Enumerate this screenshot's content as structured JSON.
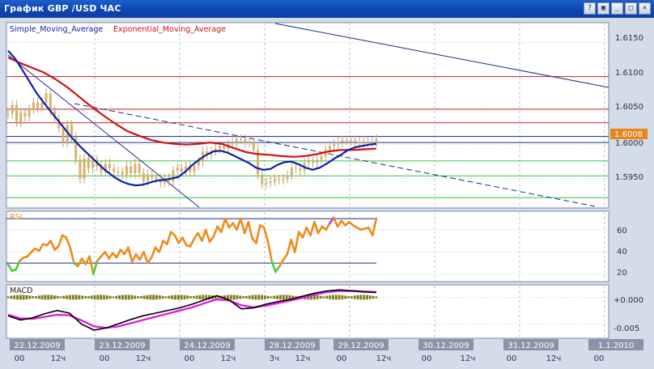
{
  "window": {
    "title": "График GBP /USD  ЧАС",
    "buttons": [
      "?",
      "▣",
      "_",
      "□",
      "✕"
    ]
  },
  "colors": {
    "background": "#ffffff",
    "sma": "#0b1fa8",
    "ema": "#d01010",
    "rsi": "#f08a1a",
    "rsi_low": "#4ccc3c",
    "rsi_high": "#d030d0",
    "macd_main": "#000000",
    "macd_signal": "#e020e0",
    "macd_hist": "#7b7a14",
    "price_tag": "#e8841a"
  },
  "chart_data": [
    {
      "type": "line",
      "name": "price",
      "legend": [
        "Simple_Moving_Average",
        "Exponential_Moving_Average"
      ],
      "y_ticks": [
        "1.6150",
        "1.6100",
        "1.6050",
        "1.6000",
        "1.5950"
      ],
      "ylim": [
        1.5908,
        1.6178
      ],
      "current_price_label": "1.6008",
      "current_price": 1.6008,
      "grid": true,
      "horizontal_levels": {
        "red": [
          1.61,
          1.6052,
          1.6032
        ],
        "navy": [
          1.6012,
          1.6003
        ],
        "green": [
          1.5976,
          1.5954,
          1.5922
        ]
      },
      "x_index_range": [
        0,
        125
      ],
      "candles_close": [
        1.6045,
        1.6058,
        1.6033,
        1.6047,
        1.6041,
        1.6052,
        1.6062,
        1.6054,
        1.6062,
        1.6075,
        1.6049,
        1.6038,
        1.6024,
        1.6003,
        1.6029,
        1.6011,
        1.5978,
        1.595,
        1.598,
        1.5965,
        1.5978,
        1.5968,
        1.596,
        1.5972,
        1.5965,
        1.596,
        1.596,
        1.5956,
        1.5968,
        1.5958,
        1.5972,
        1.5958,
        1.5946,
        1.5956,
        1.5952,
        1.595,
        1.5944,
        1.5951,
        1.5946,
        1.5962,
        1.5966,
        1.596,
        1.5968,
        1.596,
        1.5969,
        1.5975,
        1.599,
        1.5985,
        1.599,
        1.5994,
        1.5998,
        1.5994,
        1.6001,
        1.6003,
        1.6008,
        1.6008,
        1.6003,
        1.6003,
        1.5992,
        1.5956,
        1.5942,
        1.5944,
        1.5946,
        1.5949,
        1.5948,
        1.595,
        1.5955,
        1.5966,
        1.5965,
        1.5962,
        1.5973,
        1.5975,
        1.5973,
        1.5978,
        1.5983,
        1.5992,
        1.5998,
        1.6001,
        1.6004,
        1.6006,
        1.6006,
        1.6006,
        1.6004,
        1.6002,
        1.6003,
        1.6004,
        1.6003,
        1.6008
      ],
      "sma": [
        1.6138,
        1.6126,
        1.611,
        1.6093,
        1.6076,
        1.6062,
        1.6049,
        1.6036,
        1.6023,
        1.601,
        1.5999,
        1.5989,
        1.5979,
        1.5969,
        1.596,
        1.5952,
        1.5946,
        1.5942,
        1.594,
        1.5941,
        1.5944,
        1.5947,
        1.5948,
        1.595,
        1.5952,
        1.596,
        1.597,
        1.5978,
        1.5985,
        1.599,
        1.5991,
        1.5988,
        1.5983,
        1.5978,
        1.5973,
        1.5966,
        1.5963,
        1.5964,
        1.597,
        1.5974,
        1.5975,
        1.5971,
        1.5966,
        1.5963,
        1.5966,
        1.5972,
        1.5979,
        1.5985,
        1.5992,
        1.5996,
        1.5998,
        1.6,
        1.6001
      ],
      "ema": [
        1.6128,
        1.612,
        1.6113,
        1.6106,
        1.6096,
        1.6084,
        1.607,
        1.6056,
        1.6043,
        1.6031,
        1.602,
        1.6013,
        1.6007,
        1.6003,
        1.6001,
        1.6,
        1.6001,
        1.6003,
        1.6001,
        1.5995,
        1.5989,
        1.5986,
        1.5985,
        1.5983,
        1.5982,
        1.5983,
        1.5986,
        1.599,
        1.5992,
        1.5992,
        1.5993,
        1.5994
      ]
    },
    {
      "type": "line",
      "name": "RSI",
      "label": "RSI",
      "y_ticks": [
        "60",
        "40",
        "20"
      ],
      "ylim": [
        14,
        76
      ],
      "levels": [
        70,
        30
      ],
      "values": [
        29,
        23,
        24,
        32,
        35,
        36,
        40,
        43,
        41,
        47,
        46,
        50,
        42,
        45,
        55,
        53,
        44,
        30,
        27,
        34,
        29,
        36,
        20,
        32,
        36,
        40,
        34,
        39,
        35,
        42,
        38,
        44,
        31,
        38,
        33,
        40,
        30,
        35,
        44,
        40,
        50,
        47,
        58,
        55,
        48,
        53,
        46,
        45,
        52,
        57,
        50,
        60,
        49,
        54,
        63,
        58,
        70,
        62,
        66,
        60,
        70,
        57,
        67,
        52,
        48,
        64,
        62,
        50,
        32,
        22,
        27,
        33,
        38,
        51,
        40,
        58,
        53,
        62,
        55,
        67,
        57,
        63,
        60,
        66,
        71,
        63,
        68,
        64,
        67,
        64,
        62,
        60,
        61,
        62,
        55,
        70
      ]
    },
    {
      "type": "line",
      "name": "MACD",
      "label": "MACD",
      "y_ticks": [
        "+0.000",
        "-0.005"
      ],
      "ylim": [
        -0.0076,
        0.0022
      ],
      "main": [
        -0.0035,
        -0.0043,
        -0.0039,
        -0.0031,
        -0.0025,
        -0.003,
        -0.0051,
        -0.0062,
        -0.0058,
        -0.005,
        -0.0042,
        -0.0035,
        -0.003,
        -0.0025,
        -0.002,
        -0.0013,
        -0.0005,
        0.0003,
        -0.0005,
        -0.0022,
        -0.002,
        -0.0013,
        -0.0008,
        -0.0004,
        0.0002,
        0.0008,
        0.0012,
        0.0014,
        0.0012,
        0.001,
        0.0009
      ],
      "signal": [
        -0.0033,
        -0.004,
        -0.0041,
        -0.0037,
        -0.0033,
        -0.0034,
        -0.0044,
        -0.0055,
        -0.0058,
        -0.0055,
        -0.0049,
        -0.0043,
        -0.0037,
        -0.0031,
        -0.0025,
        -0.0019,
        -0.0011,
        -0.0004,
        -0.0006,
        -0.0015,
        -0.0019,
        -0.0016,
        -0.0011,
        -0.0006,
        -0.0001,
        0.0005,
        0.001,
        0.0012,
        0.0012,
        0.0011,
        0.001
      ]
    }
  ],
  "time_axis": {
    "dates": [
      "22.12.2009",
      "23.12.2009",
      "24.12.2009",
      "28.12.2009",
      "29.12.2009",
      "30.12.2009",
      "31.12.2009",
      "1.1.2010"
    ],
    "hours": [
      "00",
      "12ч",
      "00",
      "12ч",
      "00",
      "12ч",
      "3ч",
      "12ч",
      "00",
      "12ч",
      "00",
      "12ч",
      "00",
      "12ч",
      "00"
    ]
  }
}
